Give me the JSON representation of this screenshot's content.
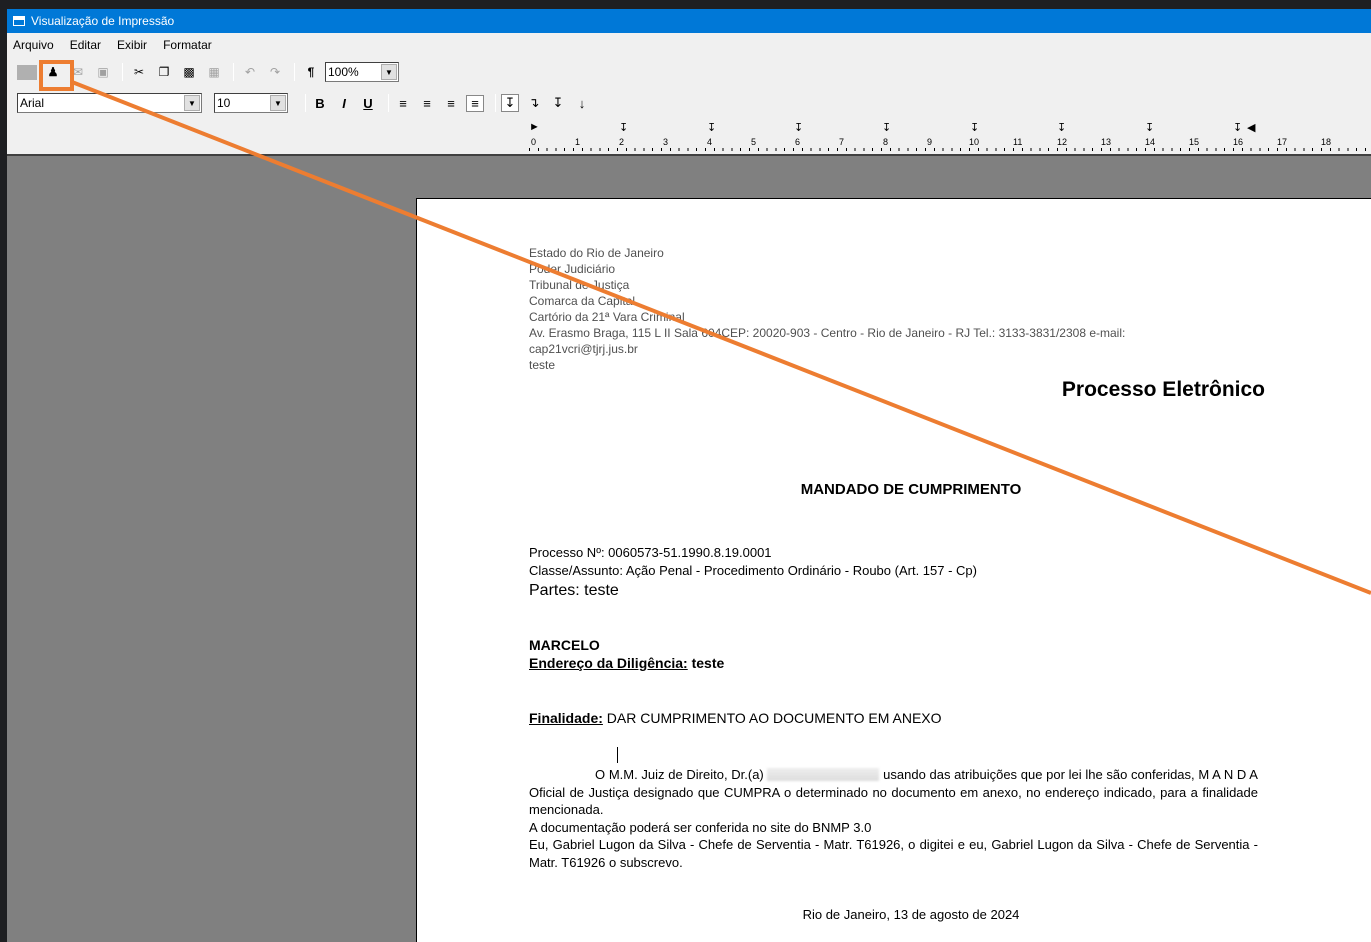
{
  "window": {
    "title": "Visualização de Impressão"
  },
  "menu": [
    "Arquivo",
    "Editar",
    "Exibir",
    "Formatar"
  ],
  "toolbar": {
    "zoom": "100%",
    "font": "Arial",
    "size": "10",
    "bold": "B",
    "italic": "I",
    "underline": "U"
  },
  "ruler": {
    "ticks": [
      "0",
      "1",
      "2",
      "3",
      "4",
      "5",
      "6",
      "7",
      "8",
      "9",
      "10",
      "11",
      "12",
      "13",
      "14",
      "15",
      "16",
      "17",
      "18"
    ]
  },
  "annotation": {
    "color": "#ed7d31"
  },
  "document": {
    "header": {
      "l1": "Estado do Rio de Janeiro",
      "l2": "Poder Judiciário",
      "l3": "Tribunal de Justiça",
      "l4": "Comarca da Capital",
      "l5": "Cartório da 21ª Vara Criminal",
      "l6": "Av. Erasmo Braga, 115 L II Sala 604CEP: 20020-903 - Centro - Rio de Janeiro - RJ Tel.: 3133-3831/2308 e-mail:",
      "l7": "cap21vcri@tjrj.jus.br",
      "l8": "teste"
    },
    "title": "Processo Eletrônico",
    "subtitle": "MANDADO DE CUMPRIMENTO",
    "processo": "Processo Nº: 0060573-51.1990.8.19.0001",
    "classe": "Classe/Assunto: Ação Penal - Procedimento Ordinário - Roubo (Art. 157 - Cp)",
    "partes": "Partes: teste",
    "nome": "MARCELO",
    "endereco_label": "Endereço da Diligência:",
    "endereco_value": " teste",
    "finalidade_label": "Finalidade:",
    "finalidade_value": " DAR CUMPRIMENTO AO DOCUMENTO EM ANEXO",
    "p1a": "O M.M. Juiz de Direito, Dr.(a)",
    "p1b": " usando das atribuições que por lei lhe são conferidas, M A N D A Oficial de Justiça designado que CUMPRA o determinado no documento em anexo, no endereço indicado, para a finalidade mencionada.",
    "p2": "A documentação poderá ser conferida no site do BNMP 3.0",
    "p3": "Eu, Gabriel Lugon da Silva - Chefe de Serventia - Matr. T61926, o digitei e eu, Gabriel Lugon da Silva - Chefe de Serventia - Matr. T61926 o subscrevo.",
    "date": "Rio de Janeiro, 13 de agosto de 2024"
  }
}
